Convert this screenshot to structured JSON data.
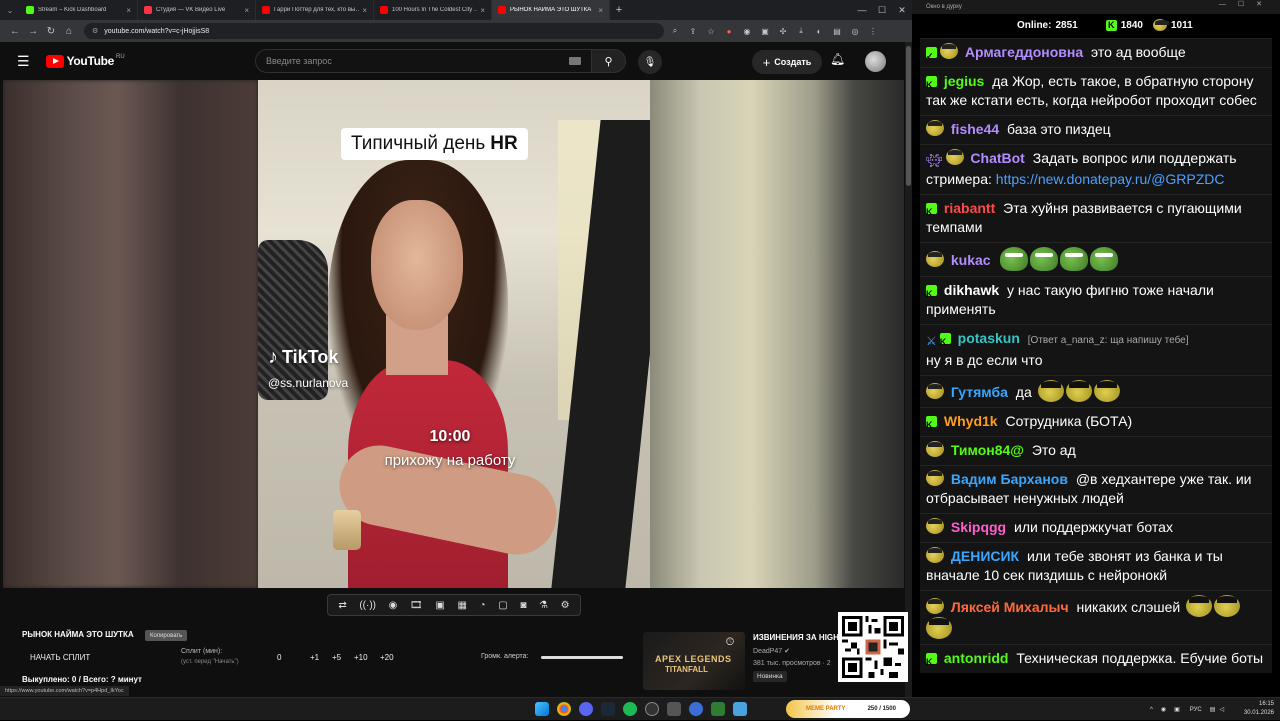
{
  "browser": {
    "tabs": [
      {
        "title": "Stream – Kick Dashboard",
        "color": "#53fc18"
      },
      {
        "title": "Студия — VK Видео Live",
        "color": "#ff3347"
      },
      {
        "title": "Гарри Поттер для тех, кто вы…",
        "color": "#ff0000"
      },
      {
        "title": "100 Hours In The Coldest City …",
        "color": "#ff0000"
      },
      {
        "title": "РЫНОК НАЙМА ЭТО ШУТКА",
        "color": "#ff0000"
      }
    ],
    "url": "youtube.com/watch?v=c-jHojjisS8"
  },
  "youtube": {
    "logo_text": "YouTube",
    "region": "RU",
    "search_placeholder": "Введите запрос",
    "create_label": "Создать"
  },
  "video": {
    "overlay_title_prefix": "Типичный день",
    "overlay_title_bold": "HR",
    "tiktok_brand": "TikTok",
    "tiktok_handle": "@ss.nurlanova",
    "time_caption": "10:00",
    "caption": "прихожу на работу"
  },
  "panel": {
    "title": "РЫНОК НАЙМА ЭТО ШУТКА",
    "copy_label": "Копировать",
    "start_split": "НАЧАТЬ СПЛИТ",
    "split_label": "Сплит (мин):",
    "split_sub": "(уст. перед \"Начать\")",
    "split_values": [
      "0",
      "+1",
      "+5",
      "+10",
      "+20"
    ],
    "alert_label": "Громк. алерта:",
    "alert_volume": 1.0,
    "bought": "Выкуплено: 0 / Всего: ? минут",
    "status_url": "https://www.youtube.com/watch?v=p4Hpd_IkYoc"
  },
  "recommendation": {
    "thumb_line1": "APEX LEGENDS",
    "thumb_line2": "TITANFALL",
    "title": "ИЗВИНЕНИЯ ЗА HIGH",
    "channel": "DeadP47",
    "views": "381 тыс. просмотров · 2",
    "badge": "Новинка"
  },
  "chat": {
    "window_title": "Окно в дурку",
    "online_label": "Online:",
    "online_count": "2851",
    "kick_count": "1840",
    "other_count": "1011",
    "messages": [
      {
        "user": "Армагеддоновна",
        "color": "#b48cff",
        "text": "это ад вообще"
      },
      {
        "user": "jegius",
        "color": "#53fc18",
        "text": "да Жор, есть такое, в обратную сторону так же кстати есть, когда нейробот проходит собес"
      },
      {
        "user": "fishe44",
        "color": "#b48cff",
        "text": "база это пиздец"
      },
      {
        "user": "ChatBot",
        "color": "#b48cff",
        "text": "Задать вопрос или поддержать стримера:",
        "link": "https://new.donatepay.ru/@GRPZDC"
      },
      {
        "user": "riabantt",
        "color": "#ff4a4a",
        "text": "Эта хуйня развивается с пугающими темпами"
      },
      {
        "user": "kukac",
        "color": "#b48cff",
        "text": ""
      },
      {
        "user": "dikhawk",
        "color": "#ffffff",
        "text": "у нас такую фигню тоже начали применять"
      },
      {
        "user": "potaskun",
        "color": "#34c6c6",
        "reply": "[Ответ a_nana_z: ща напишу тебе]",
        "text": "ну я в дс если что"
      },
      {
        "user": "Гутямба",
        "color": "#3aa7ff",
        "text": "да"
      },
      {
        "user": "Whyd1k",
        "color": "#ff9d1c",
        "text": "Сотрудника (БОТА)"
      },
      {
        "user": "Тимон84@",
        "color": "#53fc18",
        "text": "Это ад"
      },
      {
        "user": "Вадим Барханов",
        "color": "#3aa7ff",
        "text": "@в хедхантере уже так. ии отбрасывает ненужных людей"
      },
      {
        "user": "Skipqgg",
        "color": "#ff5fcf",
        "text": "или поддержкучат ботах"
      },
      {
        "user": "ДЕНИСИК",
        "color": "#3aa7ff",
        "text": "или тебе звонят из банка и ты вначале 10 сек пиздишь с нейронокй"
      },
      {
        "user": "Ляксей Михалыч",
        "color": "#ff6a3d",
        "text": "никаких слэшей"
      },
      {
        "user": "antonridd",
        "color": "#53fc18",
        "text": "Техническая поддержка. Ебучие боты"
      }
    ]
  },
  "taskbar": {
    "meme_left": "MEME PARTY",
    "meme_right": "250 / 1500",
    "lang": "РУС",
    "time": "16:15",
    "date": "30.01.2026"
  }
}
